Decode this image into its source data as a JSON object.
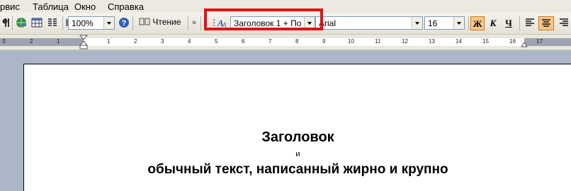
{
  "menu": {
    "items": [
      "рвис",
      "Таблица",
      "Окно",
      "Справка"
    ]
  },
  "toolbar": {
    "zoom": "100%",
    "read_label": "Чтение",
    "style": "Заголовок 1 + По",
    "font": "Arial",
    "size": "16",
    "bold": "Ж",
    "italic": "К",
    "underline": "Ч"
  },
  "ruler": {
    "labels": [
      "3",
      "2",
      "1",
      "1",
      "2",
      "3",
      "4",
      "5",
      "6",
      "7",
      "8",
      "9",
      "10",
      "11",
      "12",
      "13",
      "14",
      "15",
      "16",
      "17"
    ]
  },
  "document": {
    "heading": "Заголовок",
    "conjunction": "и",
    "body": "обычный текст, написанный жирно и крупно"
  },
  "colors": {
    "highlight_frame": "#e01313",
    "active_button": "#f8c68a",
    "workspace": "#abb7c9"
  }
}
